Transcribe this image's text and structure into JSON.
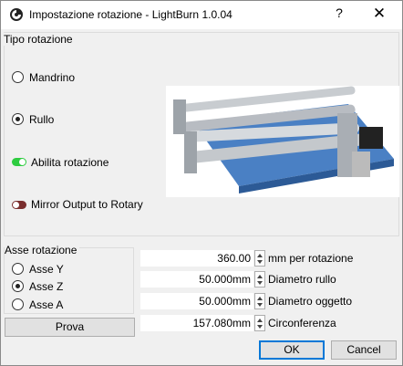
{
  "window": {
    "title": "Impostazione rotazione - LightBurn 1.0.04",
    "help_label": "?",
    "close_label": "✕"
  },
  "rotation_type": {
    "group_label": "Tipo rotazione",
    "options": [
      {
        "label": "Mandrino",
        "checked": false
      },
      {
        "label": "Rullo",
        "checked": true
      }
    ],
    "enable_toggle": {
      "label": "Abilita rotazione",
      "on": true,
      "color": "#2ecc40"
    },
    "mirror_toggle": {
      "label": "Mirror Output to Rotary",
      "on": false,
      "color": "#7a2e2e"
    }
  },
  "rotary_axis": {
    "group_label": "Asse rotazione",
    "options": [
      {
        "label": "Asse Y",
        "checked": false
      },
      {
        "label": "Asse Z",
        "checked": true
      },
      {
        "label": "Asse A",
        "checked": false
      }
    ],
    "test_button": "Prova"
  },
  "settings": [
    {
      "value": "360.00",
      "label": "mm per rotazione"
    },
    {
      "value": "50.000mm",
      "label": "Diametro rullo"
    },
    {
      "value": "50.000mm",
      "label": "Diametro oggetto"
    },
    {
      "value": "157.080mm",
      "label": "Circonferenza"
    }
  ],
  "footer": {
    "ok_label": "OK",
    "cancel_label": "Cancel",
    "accent": "#0078d7"
  }
}
